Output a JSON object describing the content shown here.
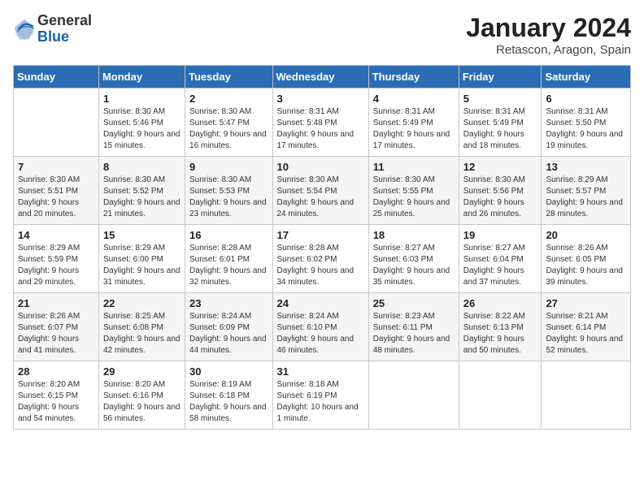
{
  "logo": {
    "general": "General",
    "blue": "Blue"
  },
  "title": "January 2024",
  "subtitle": "Retascon, Aragon, Spain",
  "headers": [
    "Sunday",
    "Monday",
    "Tuesday",
    "Wednesday",
    "Thursday",
    "Friday",
    "Saturday"
  ],
  "weeks": [
    [
      {
        "day": "",
        "sunrise": "",
        "sunset": "",
        "daylight": ""
      },
      {
        "day": "1",
        "sunrise": "Sunrise: 8:30 AM",
        "sunset": "Sunset: 5:46 PM",
        "daylight": "Daylight: 9 hours and 15 minutes."
      },
      {
        "day": "2",
        "sunrise": "Sunrise: 8:30 AM",
        "sunset": "Sunset: 5:47 PM",
        "daylight": "Daylight: 9 hours and 16 minutes."
      },
      {
        "day": "3",
        "sunrise": "Sunrise: 8:31 AM",
        "sunset": "Sunset: 5:48 PM",
        "daylight": "Daylight: 9 hours and 17 minutes."
      },
      {
        "day": "4",
        "sunrise": "Sunrise: 8:31 AM",
        "sunset": "Sunset: 5:49 PM",
        "daylight": "Daylight: 9 hours and 17 minutes."
      },
      {
        "day": "5",
        "sunrise": "Sunrise: 8:31 AM",
        "sunset": "Sunset: 5:49 PM",
        "daylight": "Daylight: 9 hours and 18 minutes."
      },
      {
        "day": "6",
        "sunrise": "Sunrise: 8:31 AM",
        "sunset": "Sunset: 5:50 PM",
        "daylight": "Daylight: 9 hours and 19 minutes."
      }
    ],
    [
      {
        "day": "7",
        "sunrise": "Sunrise: 8:30 AM",
        "sunset": "Sunset: 5:51 PM",
        "daylight": "Daylight: 9 hours and 20 minutes."
      },
      {
        "day": "8",
        "sunrise": "Sunrise: 8:30 AM",
        "sunset": "Sunset: 5:52 PM",
        "daylight": "Daylight: 9 hours and 21 minutes."
      },
      {
        "day": "9",
        "sunrise": "Sunrise: 8:30 AM",
        "sunset": "Sunset: 5:53 PM",
        "daylight": "Daylight: 9 hours and 23 minutes."
      },
      {
        "day": "10",
        "sunrise": "Sunrise: 8:30 AM",
        "sunset": "Sunset: 5:54 PM",
        "daylight": "Daylight: 9 hours and 24 minutes."
      },
      {
        "day": "11",
        "sunrise": "Sunrise: 8:30 AM",
        "sunset": "Sunset: 5:55 PM",
        "daylight": "Daylight: 9 hours and 25 minutes."
      },
      {
        "day": "12",
        "sunrise": "Sunrise: 8:30 AM",
        "sunset": "Sunset: 5:56 PM",
        "daylight": "Daylight: 9 hours and 26 minutes."
      },
      {
        "day": "13",
        "sunrise": "Sunrise: 8:29 AM",
        "sunset": "Sunset: 5:57 PM",
        "daylight": "Daylight: 9 hours and 28 minutes."
      }
    ],
    [
      {
        "day": "14",
        "sunrise": "Sunrise: 8:29 AM",
        "sunset": "Sunset: 5:59 PM",
        "daylight": "Daylight: 9 hours and 29 minutes."
      },
      {
        "day": "15",
        "sunrise": "Sunrise: 8:29 AM",
        "sunset": "Sunset: 6:00 PM",
        "daylight": "Daylight: 9 hours and 31 minutes."
      },
      {
        "day": "16",
        "sunrise": "Sunrise: 8:28 AM",
        "sunset": "Sunset: 6:01 PM",
        "daylight": "Daylight: 9 hours and 32 minutes."
      },
      {
        "day": "17",
        "sunrise": "Sunrise: 8:28 AM",
        "sunset": "Sunset: 6:02 PM",
        "daylight": "Daylight: 9 hours and 34 minutes."
      },
      {
        "day": "18",
        "sunrise": "Sunrise: 8:27 AM",
        "sunset": "Sunset: 6:03 PM",
        "daylight": "Daylight: 9 hours and 35 minutes."
      },
      {
        "day": "19",
        "sunrise": "Sunrise: 8:27 AM",
        "sunset": "Sunset: 6:04 PM",
        "daylight": "Daylight: 9 hours and 37 minutes."
      },
      {
        "day": "20",
        "sunrise": "Sunrise: 8:26 AM",
        "sunset": "Sunset: 6:05 PM",
        "daylight": "Daylight: 9 hours and 39 minutes."
      }
    ],
    [
      {
        "day": "21",
        "sunrise": "Sunrise: 8:26 AM",
        "sunset": "Sunset: 6:07 PM",
        "daylight": "Daylight: 9 hours and 41 minutes."
      },
      {
        "day": "22",
        "sunrise": "Sunrise: 8:25 AM",
        "sunset": "Sunset: 6:08 PM",
        "daylight": "Daylight: 9 hours and 42 minutes."
      },
      {
        "day": "23",
        "sunrise": "Sunrise: 8:24 AM",
        "sunset": "Sunset: 6:09 PM",
        "daylight": "Daylight: 9 hours and 44 minutes."
      },
      {
        "day": "24",
        "sunrise": "Sunrise: 8:24 AM",
        "sunset": "Sunset: 6:10 PM",
        "daylight": "Daylight: 9 hours and 46 minutes."
      },
      {
        "day": "25",
        "sunrise": "Sunrise: 8:23 AM",
        "sunset": "Sunset: 6:11 PM",
        "daylight": "Daylight: 9 hours and 48 minutes."
      },
      {
        "day": "26",
        "sunrise": "Sunrise: 8:22 AM",
        "sunset": "Sunset: 6:13 PM",
        "daylight": "Daylight: 9 hours and 50 minutes."
      },
      {
        "day": "27",
        "sunrise": "Sunrise: 8:21 AM",
        "sunset": "Sunset: 6:14 PM",
        "daylight": "Daylight: 9 hours and 52 minutes."
      }
    ],
    [
      {
        "day": "28",
        "sunrise": "Sunrise: 8:20 AM",
        "sunset": "Sunset: 6:15 PM",
        "daylight": "Daylight: 9 hours and 54 minutes."
      },
      {
        "day": "29",
        "sunrise": "Sunrise: 8:20 AM",
        "sunset": "Sunset: 6:16 PM",
        "daylight": "Daylight: 9 hours and 56 minutes."
      },
      {
        "day": "30",
        "sunrise": "Sunrise: 8:19 AM",
        "sunset": "Sunset: 6:18 PM",
        "daylight": "Daylight: 9 hours and 58 minutes."
      },
      {
        "day": "31",
        "sunrise": "Sunrise: 8:18 AM",
        "sunset": "Sunset: 6:19 PM",
        "daylight": "Daylight: 10 hours and 1 minute."
      },
      {
        "day": "",
        "sunrise": "",
        "sunset": "",
        "daylight": ""
      },
      {
        "day": "",
        "sunrise": "",
        "sunset": "",
        "daylight": ""
      },
      {
        "day": "",
        "sunrise": "",
        "sunset": "",
        "daylight": ""
      }
    ]
  ]
}
